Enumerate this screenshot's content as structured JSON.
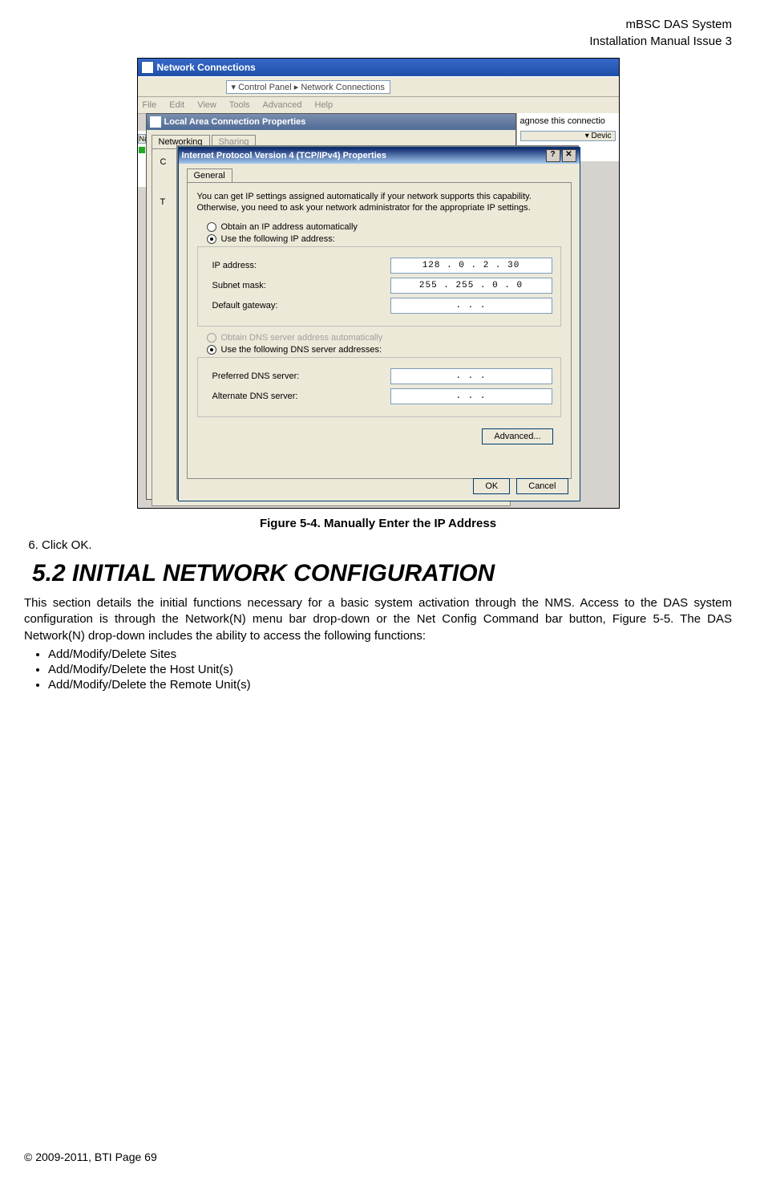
{
  "header": {
    "line1": "mBSC DAS System",
    "line2": "Installation Manual Issue 3"
  },
  "screenshot": {
    "nc_title": "Network Connections",
    "breadcrumb_prefix": "▾  Control Panel  ▸  Network Connections",
    "menubar": [
      "File",
      "Edit",
      "View",
      "Tools",
      "Advanced",
      "Help"
    ],
    "right_text1": "agnose this connectio",
    "right_text2": "▾  Devic",
    "close_x": "✕",
    "nav_n": "Na",
    "lac": {
      "title": "Local Area Connection Properties",
      "tabs": [
        "Networking",
        "Sharing"
      ],
      "c_label": "C",
      "t_label": "T"
    },
    "ipv4": {
      "title": "Internet Protocol Version 4 (TCP/IPv4) Properties",
      "help": "?",
      "close": "✕",
      "tab": "General",
      "info": "You can get IP settings assigned automatically if your network supports this capability. Otherwise, you need to ask your network administrator for the appropriate IP settings.",
      "radio_auto_ip": "Obtain an IP address automatically",
      "radio_use_ip": "Use the following IP address:",
      "ip_label": "IP address:",
      "ip_value": "128 .  0   .  2   .  30",
      "subnet_label": "Subnet mask:",
      "subnet_value": "255 . 255 .  0   .  0",
      "gateway_label": "Default gateway:",
      "gateway_value": ".        .        .",
      "radio_auto_dns": "Obtain DNS server address automatically",
      "radio_use_dns": "Use the following DNS server addresses:",
      "pref_dns_label": "Preferred DNS server:",
      "pref_dns_value": ".        .        .",
      "alt_dns_label": "Alternate DNS server:",
      "alt_dns_value": ".        .        .",
      "advanced": "Advanced...",
      "ok": "OK",
      "cancel": "Cancel"
    }
  },
  "caption": "Figure 5-4. Manually Enter the IP Address",
  "step6": "Click OK.",
  "section_heading": "5.2  INITIAL NETWORK CONFIGURATION",
  "para": "This section details the initial functions necessary for a basic system activation through the NMS. Access to the DAS system configuration is through the Network(N) menu bar drop-down or the Net Config Command bar button, Figure 5-5. The DAS Network(N) drop-down includes the ability to access the following functions:",
  "bullets": [
    "Add/Modify/Delete Sites",
    "Add/Modify/Delete the Host Unit(s)",
    "Add/Modify/Delete the Remote Unit(s)"
  ],
  "footer": "© 2009‑2011, BTI Page 69"
}
